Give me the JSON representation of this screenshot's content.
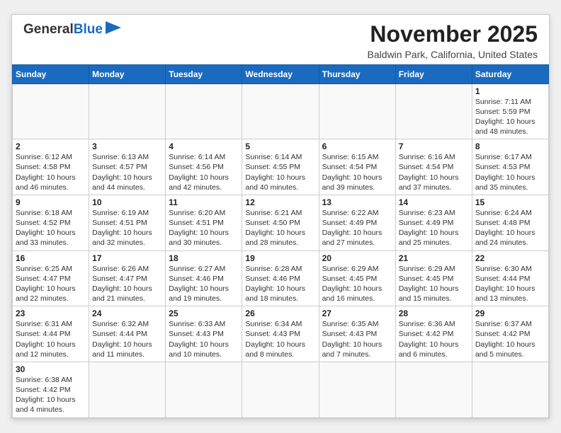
{
  "header": {
    "title": "November 2025",
    "location": "Baldwin Park, California, United States",
    "logo_text1": "General",
    "logo_text2": "Blue"
  },
  "days_of_week": [
    "Sunday",
    "Monday",
    "Tuesday",
    "Wednesday",
    "Thursday",
    "Friday",
    "Saturday"
  ],
  "weeks": [
    [
      {
        "day": "",
        "info": ""
      },
      {
        "day": "",
        "info": ""
      },
      {
        "day": "",
        "info": ""
      },
      {
        "day": "",
        "info": ""
      },
      {
        "day": "",
        "info": ""
      },
      {
        "day": "",
        "info": ""
      },
      {
        "day": "1",
        "info": "Sunrise: 7:11 AM\nSunset: 5:59 PM\nDaylight: 10 hours\nand 48 minutes."
      }
    ],
    [
      {
        "day": "2",
        "info": "Sunrise: 6:12 AM\nSunset: 4:58 PM\nDaylight: 10 hours\nand 46 minutes."
      },
      {
        "day": "3",
        "info": "Sunrise: 6:13 AM\nSunset: 4:57 PM\nDaylight: 10 hours\nand 44 minutes."
      },
      {
        "day": "4",
        "info": "Sunrise: 6:14 AM\nSunset: 4:56 PM\nDaylight: 10 hours\nand 42 minutes."
      },
      {
        "day": "5",
        "info": "Sunrise: 6:14 AM\nSunset: 4:55 PM\nDaylight: 10 hours\nand 40 minutes."
      },
      {
        "day": "6",
        "info": "Sunrise: 6:15 AM\nSunset: 4:54 PM\nDaylight: 10 hours\nand 39 minutes."
      },
      {
        "day": "7",
        "info": "Sunrise: 6:16 AM\nSunset: 4:54 PM\nDaylight: 10 hours\nand 37 minutes."
      },
      {
        "day": "8",
        "info": "Sunrise: 6:17 AM\nSunset: 4:53 PM\nDaylight: 10 hours\nand 35 minutes."
      }
    ],
    [
      {
        "day": "9",
        "info": "Sunrise: 6:18 AM\nSunset: 4:52 PM\nDaylight: 10 hours\nand 33 minutes."
      },
      {
        "day": "10",
        "info": "Sunrise: 6:19 AM\nSunset: 4:51 PM\nDaylight: 10 hours\nand 32 minutes."
      },
      {
        "day": "11",
        "info": "Sunrise: 6:20 AM\nSunset: 4:51 PM\nDaylight: 10 hours\nand 30 minutes."
      },
      {
        "day": "12",
        "info": "Sunrise: 6:21 AM\nSunset: 4:50 PM\nDaylight: 10 hours\nand 28 minutes."
      },
      {
        "day": "13",
        "info": "Sunrise: 6:22 AM\nSunset: 4:49 PM\nDaylight: 10 hours\nand 27 minutes."
      },
      {
        "day": "14",
        "info": "Sunrise: 6:23 AM\nSunset: 4:49 PM\nDaylight: 10 hours\nand 25 minutes."
      },
      {
        "day": "15",
        "info": "Sunrise: 6:24 AM\nSunset: 4:48 PM\nDaylight: 10 hours\nand 24 minutes."
      }
    ],
    [
      {
        "day": "16",
        "info": "Sunrise: 6:25 AM\nSunset: 4:47 PM\nDaylight: 10 hours\nand 22 minutes."
      },
      {
        "day": "17",
        "info": "Sunrise: 6:26 AM\nSunset: 4:47 PM\nDaylight: 10 hours\nand 21 minutes."
      },
      {
        "day": "18",
        "info": "Sunrise: 6:27 AM\nSunset: 4:46 PM\nDaylight: 10 hours\nand 19 minutes."
      },
      {
        "day": "19",
        "info": "Sunrise: 6:28 AM\nSunset: 4:46 PM\nDaylight: 10 hours\nand 18 minutes."
      },
      {
        "day": "20",
        "info": "Sunrise: 6:29 AM\nSunset: 4:45 PM\nDaylight: 10 hours\nand 16 minutes."
      },
      {
        "day": "21",
        "info": "Sunrise: 6:29 AM\nSunset: 4:45 PM\nDaylight: 10 hours\nand 15 minutes."
      },
      {
        "day": "22",
        "info": "Sunrise: 6:30 AM\nSunset: 4:44 PM\nDaylight: 10 hours\nand 13 minutes."
      }
    ],
    [
      {
        "day": "23",
        "info": "Sunrise: 6:31 AM\nSunset: 4:44 PM\nDaylight: 10 hours\nand 12 minutes."
      },
      {
        "day": "24",
        "info": "Sunrise: 6:32 AM\nSunset: 4:44 PM\nDaylight: 10 hours\nand 11 minutes."
      },
      {
        "day": "25",
        "info": "Sunrise: 6:33 AM\nSunset: 4:43 PM\nDaylight: 10 hours\nand 10 minutes."
      },
      {
        "day": "26",
        "info": "Sunrise: 6:34 AM\nSunset: 4:43 PM\nDaylight: 10 hours\nand 8 minutes."
      },
      {
        "day": "27",
        "info": "Sunrise: 6:35 AM\nSunset: 4:43 PM\nDaylight: 10 hours\nand 7 minutes."
      },
      {
        "day": "28",
        "info": "Sunrise: 6:36 AM\nSunset: 4:42 PM\nDaylight: 10 hours\nand 6 minutes."
      },
      {
        "day": "29",
        "info": "Sunrise: 6:37 AM\nSunset: 4:42 PM\nDaylight: 10 hours\nand 5 minutes."
      }
    ],
    [
      {
        "day": "30",
        "info": "Sunrise: 6:38 AM\nSunset: 4:42 PM\nDaylight: 10 hours\nand 4 minutes."
      },
      {
        "day": "",
        "info": ""
      },
      {
        "day": "",
        "info": ""
      },
      {
        "day": "",
        "info": ""
      },
      {
        "day": "",
        "info": ""
      },
      {
        "day": "",
        "info": ""
      },
      {
        "day": "",
        "info": ""
      }
    ]
  ]
}
